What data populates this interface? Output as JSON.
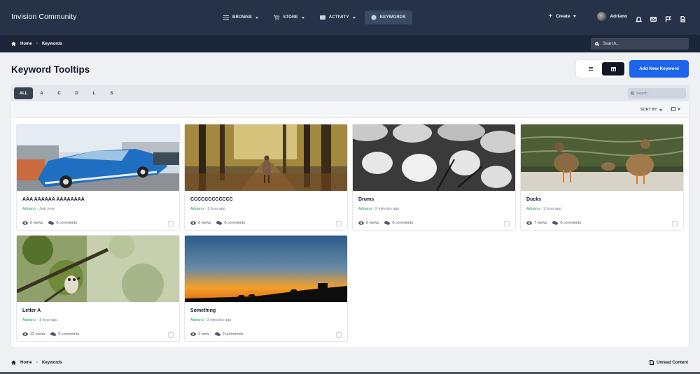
{
  "brand": "Invision Community",
  "nav": [
    {
      "label": "BROWSE",
      "icon": "menu-icon",
      "active": false
    },
    {
      "label": "STORE",
      "icon": "cart-icon",
      "active": false
    },
    {
      "label": "ACTIVITY",
      "icon": "activity-icon",
      "active": false
    },
    {
      "label": "KEYWORDS",
      "icon": "globe-icon",
      "active": true
    }
  ],
  "header_tools": {
    "create_label": "Create",
    "user_name": "Adriano",
    "icons": [
      "bell-icon",
      "envelope-icon",
      "flag-icon",
      "document-icon"
    ]
  },
  "breadcrumb": {
    "home": "Home",
    "current": "Keywords"
  },
  "search": {
    "placeholder": "Search..."
  },
  "page": {
    "title": "Keyword Tooltips",
    "add_button": "Add New Keyword",
    "view_modes": [
      "list-view-icon",
      "grid-view-icon"
    ],
    "active_view": "grid"
  },
  "filter": {
    "letters": [
      "ALL",
      "A",
      "C",
      "D",
      "L",
      "S"
    ],
    "active": "ALL",
    "search_placeholder": "Search..."
  },
  "sort": {
    "label": "SORT BY"
  },
  "cards": [
    {
      "title": "AAA AAAAAA AAAAAAAA",
      "author": "Adriano",
      "time": "Just now",
      "views": "0 views",
      "comments": "0 comments",
      "image": "blue-vintage-car"
    },
    {
      "title": "CCCCCCCCCCCC",
      "author": "Adriano",
      "time": "1 hour ago",
      "views": "6 views",
      "comments": "0 comments",
      "image": "forest-path-walker"
    },
    {
      "title": "Drums",
      "author": "Adriano",
      "time": "2 minutes ago",
      "views": "0 views",
      "comments": "0 comments",
      "image": "drum-kit-bw"
    },
    {
      "title": "Ducks",
      "author": "Adriano",
      "time": "1 hour ago",
      "views": "7 views",
      "comments": "0 comments",
      "image": "ducks-by-water"
    },
    {
      "title": "Letter A",
      "author": "Adriano",
      "time": "1 hour ago",
      "views": "12 views",
      "comments": "0 comments",
      "image": "owl-in-tree"
    },
    {
      "title": "Something",
      "author": "Adriano",
      "time": "3 minutes ago",
      "views": "1 view",
      "comments": "0 comments",
      "image": "sunset-silhouette"
    }
  ],
  "footer": {
    "home": "Home",
    "current": "Keywords",
    "unread": "Unread Content"
  },
  "colors": {
    "header": "#263248",
    "breadcrumb_bar": "#1c2638",
    "accent": "#1d63ed",
    "author": "#16a34a"
  }
}
